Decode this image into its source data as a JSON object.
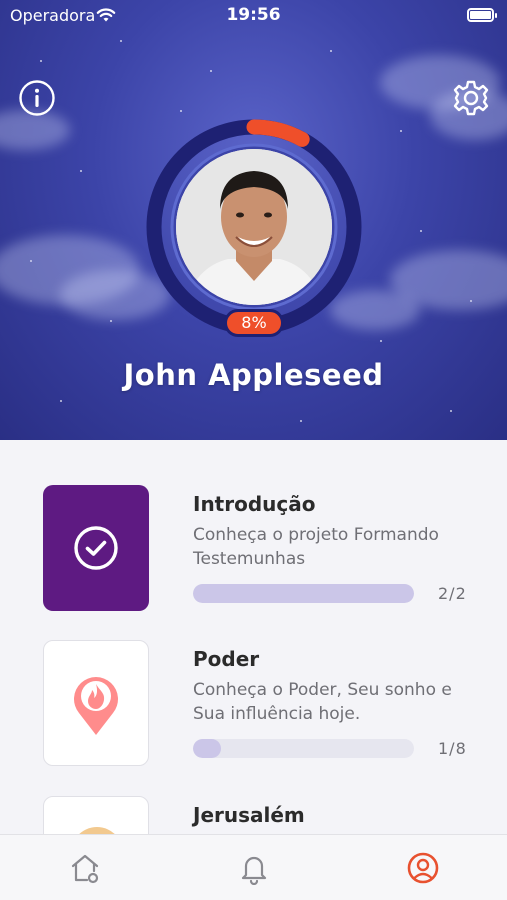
{
  "status_bar": {
    "carrier": "Operadora",
    "time": "19:56"
  },
  "profile": {
    "name": "John Appleseed",
    "progress_percent": 8,
    "progress_label": "8%"
  },
  "icons": {
    "info": "info-icon",
    "settings": "gear-icon",
    "check": "check-circle-icon",
    "fire_pin": "fire-pin-icon",
    "home": "home-icon",
    "bell": "bell-icon",
    "profile": "profile-icon"
  },
  "colors": {
    "header_bg": "#3c44a8",
    "accent": "#ef4f2a",
    "ring": "#1e2173",
    "intro_tile": "#5e1a82",
    "progress_fill": "#cbc6e8"
  },
  "courses": [
    {
      "title": "Introdução",
      "description": "Conheça o projeto Formando Testemunhas",
      "progress": "2/2",
      "fraction": 1.0
    },
    {
      "title": "Poder",
      "description": "Conheça o Poder, Seu sonho e Sua influência hoje.",
      "progress": "1/8",
      "fraction": 0.125
    },
    {
      "title": "Jerusalém"
    }
  ],
  "tabbar": {
    "active": "profile"
  }
}
